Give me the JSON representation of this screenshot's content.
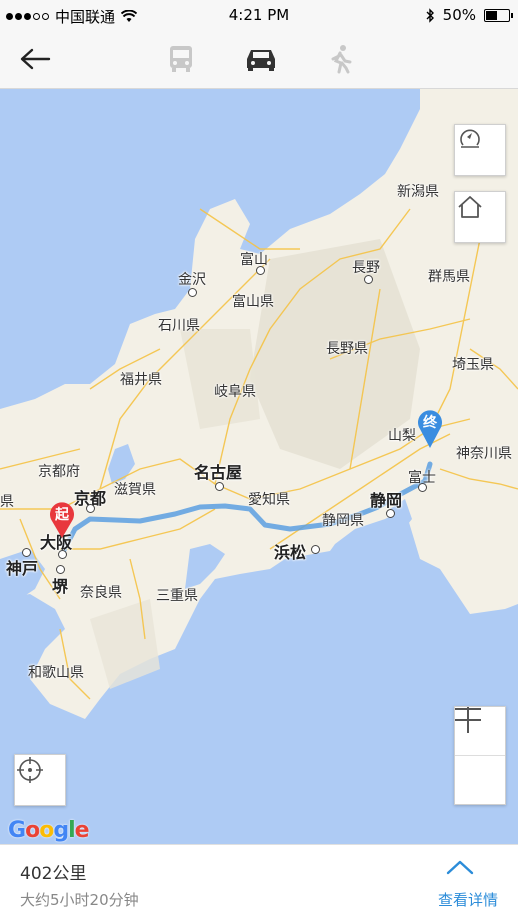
{
  "status_bar": {
    "carrier": "中国联通",
    "time": "4:21 PM",
    "battery": "50%",
    "battery_level": 0.5
  },
  "nav": {
    "back_icon": "arrow-left-icon",
    "modes": [
      {
        "name": "bus",
        "icon": "bus-icon",
        "active": false
      },
      {
        "name": "car",
        "icon": "car-icon",
        "active": true
      },
      {
        "name": "walk",
        "icon": "walk-icon",
        "active": false
      }
    ]
  },
  "map": {
    "labels": {
      "niigata_pref": "新潟県",
      "toyama": "富山",
      "nagano": "長野",
      "gunma": "群馬県",
      "kanazawa": "金沢",
      "toyama_pref": "富山県",
      "ishikawa": "石川県",
      "nagano_pref": "長野県",
      "saitama": "埼玉県",
      "fukui": "福井県",
      "gifu": "岐阜県",
      "yamanashi": "山梨",
      "kanagawa": "神奈川県",
      "kyoto_pref": "京都府",
      "nagoya": "名古屋",
      "fuji": "富士",
      "kyoto": "京都",
      "shiga": "滋賀県",
      "aichi": "愛知県",
      "shizuoka": "静岡",
      "osaka": "大阪",
      "shizuoka_pref": "静岡県",
      "hamamatsu": "浜松",
      "kobe": "神戸",
      "sakai": "堺",
      "nara": "奈良県",
      "mie": "三重県",
      "wakayama": "和歌山県",
      "hyogo_partial": "県"
    },
    "start_marker": "起",
    "end_marker": "终",
    "google_logo": "Google",
    "route_color": "#5a9fe0",
    "start_color": "#e8383d",
    "end_color": "#3a8de0"
  },
  "controls": {
    "compass_icon": "compass-icon",
    "home_icon": "home-icon",
    "locate_icon": "locate-icon",
    "zoom_out_icon": "minus-icon",
    "zoom_in_icon": "plus-icon"
  },
  "bottom": {
    "distance": "402公里",
    "duration": "大约5小时20分钟",
    "details": "查看详情",
    "chevron_icon": "chevron-up-icon"
  }
}
